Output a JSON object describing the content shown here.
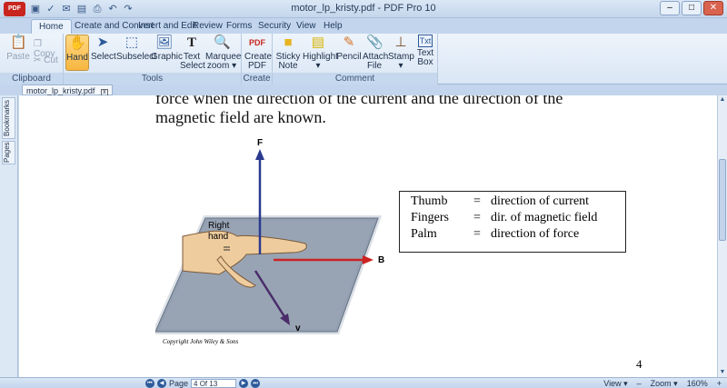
{
  "window": {
    "title": "motor_lp_kristy.pdf - PDF Pro 10",
    "logo_text": "PDF"
  },
  "tabs": [
    "Home",
    "Create and Convert",
    "Insert and Edit",
    "Review",
    "Forms",
    "Security",
    "View",
    "Help"
  ],
  "ribbon": {
    "clipboard": {
      "paste": "Paste",
      "copy": "Copy",
      "cut": "Cut",
      "label": "Clipboard"
    },
    "tools": {
      "hand": "Hand",
      "select": "Select",
      "subselect": "Subselect",
      "graphic": "Graphic",
      "text_select_1": "Text",
      "text_select_2": "Select",
      "marquee_1": "Marquee",
      "marquee_2": "zoom",
      "label": "Tools"
    },
    "create": {
      "create_1": "Create",
      "create_2": "PDF",
      "label": "Create"
    },
    "comment": {
      "sticky_1": "Sticky",
      "sticky_2": "Note",
      "highlight": "Highlight",
      "pencil": "Pencil",
      "attach_1": "Attach",
      "attach_2": "File",
      "stamp": "Stamp",
      "textbox_1": "Text",
      "textbox_2": "Box",
      "label": "Comment"
    }
  },
  "document_tab": "motor_lp_kristy.pdf",
  "side_tabs": {
    "bookmarks": "Bookmarks",
    "pages": "Pages"
  },
  "document": {
    "line1": "force when the direction of the current and the direction of the",
    "line2": "magnetic field are known.",
    "figure": {
      "f_label": "F",
      "b_label": "B",
      "v_label": "v",
      "hand_label_1": "Right",
      "hand_label_2": "hand"
    },
    "table": [
      {
        "term": "Thumb",
        "eq": "=",
        "def": "direction of current"
      },
      {
        "term": "Fingers",
        "eq": "=",
        "def": "dir. of magnetic field"
      },
      {
        "term": "Palm",
        "eq": "=",
        "def": "direction of force"
      }
    ],
    "copyright": "Copyright John Wiley & Sons",
    "page_number": "4"
  },
  "status": {
    "page_prefix": "Page",
    "page_value": "4 Of 13",
    "view": "View",
    "zoom_label": "Zoom",
    "zoom_value": "160%"
  }
}
